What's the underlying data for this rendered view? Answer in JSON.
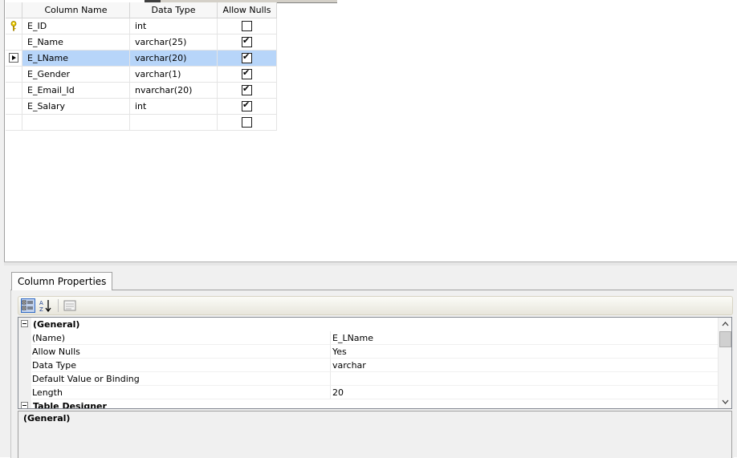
{
  "grid": {
    "headers": {
      "column_name": "Column Name",
      "data_type": "Data Type",
      "allow_nulls": "Allow Nulls"
    },
    "rows": [
      {
        "name": "E_ID",
        "type": "int",
        "allow_nulls": false,
        "primary_key": true,
        "selected": false
      },
      {
        "name": "E_Name",
        "type": "varchar(25)",
        "allow_nulls": true,
        "primary_key": false,
        "selected": false
      },
      {
        "name": "E_LName",
        "type": "varchar(20)",
        "allow_nulls": true,
        "primary_key": false,
        "selected": true
      },
      {
        "name": "E_Gender",
        "type": "varchar(1)",
        "allow_nulls": true,
        "primary_key": false,
        "selected": false
      },
      {
        "name": "E_Email_Id",
        "type": "nvarchar(20)",
        "allow_nulls": true,
        "primary_key": false,
        "selected": false
      },
      {
        "name": "E_Salary",
        "type": "int",
        "allow_nulls": true,
        "primary_key": false,
        "selected": false
      },
      {
        "name": "",
        "type": "",
        "allow_nulls": false,
        "primary_key": false,
        "selected": false
      }
    ]
  },
  "column_properties": {
    "tab_label": "Column Properties",
    "category_general": "(General)",
    "properties": [
      {
        "name": "(Name)",
        "value": "E_LName"
      },
      {
        "name": "Allow Nulls",
        "value": "Yes"
      },
      {
        "name": "Data Type",
        "value": "varchar"
      },
      {
        "name": "Default Value or Binding",
        "value": ""
      },
      {
        "name": "Length",
        "value": "20"
      }
    ],
    "category_table_designer": "Table Designer",
    "description_title": "(General)"
  },
  "icons": {
    "toolbar": [
      "categorized-icon",
      "alphabetical-sort-icon",
      "property-pages-icon"
    ],
    "primary_key": "key-icon",
    "current_row": "row-selector-arrow-icon"
  },
  "colors": {
    "selection": "#b7d5f9",
    "key": "#c8a400"
  }
}
